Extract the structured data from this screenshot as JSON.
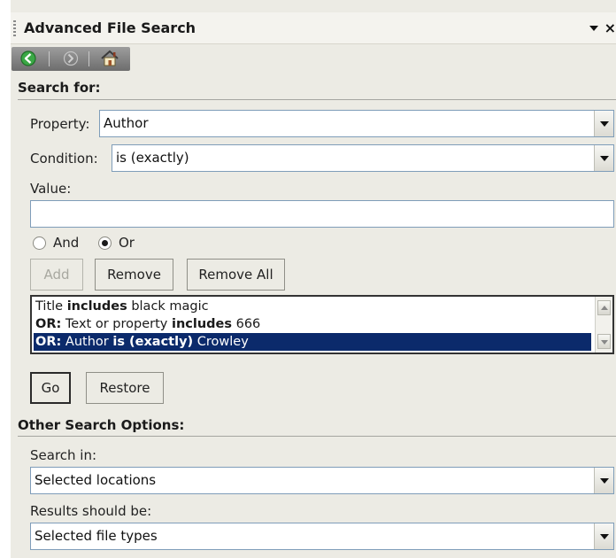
{
  "window": {
    "title": "Advanced File Search",
    "icons": [
      "grip-icon",
      "menu-arrow-icon",
      "close-icon"
    ],
    "close_glyph": "×"
  },
  "nav": {
    "icons": [
      "back-arrow-icon",
      "forward-arrow-icon",
      "home-icon"
    ]
  },
  "search_for": {
    "header": "Search for:",
    "property_label": "Property:",
    "property_value": "Author",
    "condition_label": "Condition:",
    "condition_value": "is (exactly)",
    "value_label": "Value:",
    "value_text": "",
    "and_label": "And",
    "or_label": "Or",
    "selected_logic": "Or",
    "add_label": "Add",
    "remove_label": "Remove",
    "remove_all_label": "Remove All",
    "criteria": [
      {
        "prefix": "",
        "field": "Title ",
        "op": "includes",
        "value": " black magic",
        "selected": false
      },
      {
        "prefix": "OR:",
        "field": "  Text or property ",
        "op": "includes",
        "value": " 666",
        "selected": false
      },
      {
        "prefix": "OR:",
        "field": "  Author ",
        "op": "is (exactly)",
        "value": " Crowley",
        "selected": true
      }
    ],
    "go_label": "Go",
    "restore_label": "Restore"
  },
  "other_options": {
    "header": "Other Search Options:",
    "search_in_label": "Search in:",
    "search_in_value": "Selected locations",
    "results_label": "Results should be:",
    "results_value": "Selected file types"
  },
  "colors": {
    "pane_bg": "#ecebe4",
    "selection_bg": "#0b2a6b",
    "input_border": "#7f9db9"
  }
}
